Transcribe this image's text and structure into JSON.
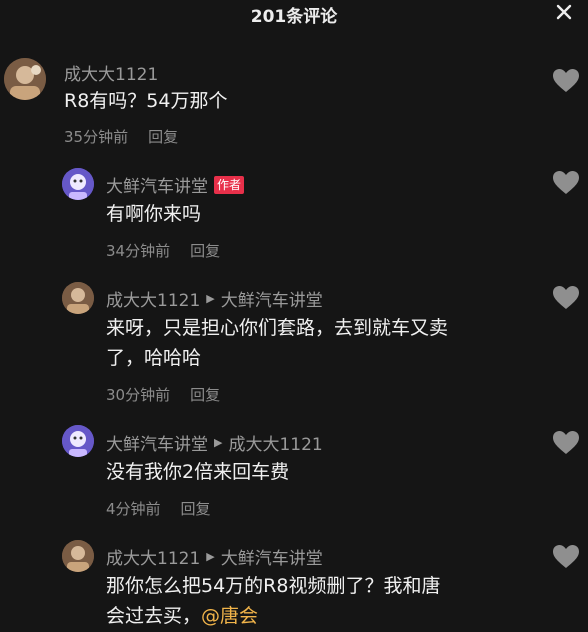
{
  "header": {
    "title": "201条评论"
  },
  "comments": [
    {
      "user": "成大大1121",
      "text": "R8有吗？54万那个",
      "time": "35分钟前",
      "reply_label": "回复"
    },
    {
      "user": "大鲜汽车讲堂",
      "badge": "作者",
      "text": "有啊你来吗",
      "time": "34分钟前",
      "reply_label": "回复"
    },
    {
      "user": "成大大1121",
      "reply_to": "大鲜汽车讲堂",
      "text_line1": "来呀，只是担心你们套路，去到就车又卖",
      "text_line2": "了，哈哈哈",
      "time": "30分钟前",
      "reply_label": "回复"
    },
    {
      "user": "大鲜汽车讲堂",
      "reply_to": "成大大1121",
      "text": "没有我你2倍来回车费",
      "time": "4分钟前",
      "reply_label": "回复"
    },
    {
      "user": "成大大1121",
      "reply_to": "大鲜汽车讲堂",
      "text_line1": "那你怎么把54万的R8视频删了？我和唐",
      "text_line2_prefix": "会过去买，",
      "mention": "@唐会"
    }
  ],
  "colors": {
    "background": "#151515",
    "author_badge": "#e8304a",
    "mention": "#f1b44a"
  }
}
